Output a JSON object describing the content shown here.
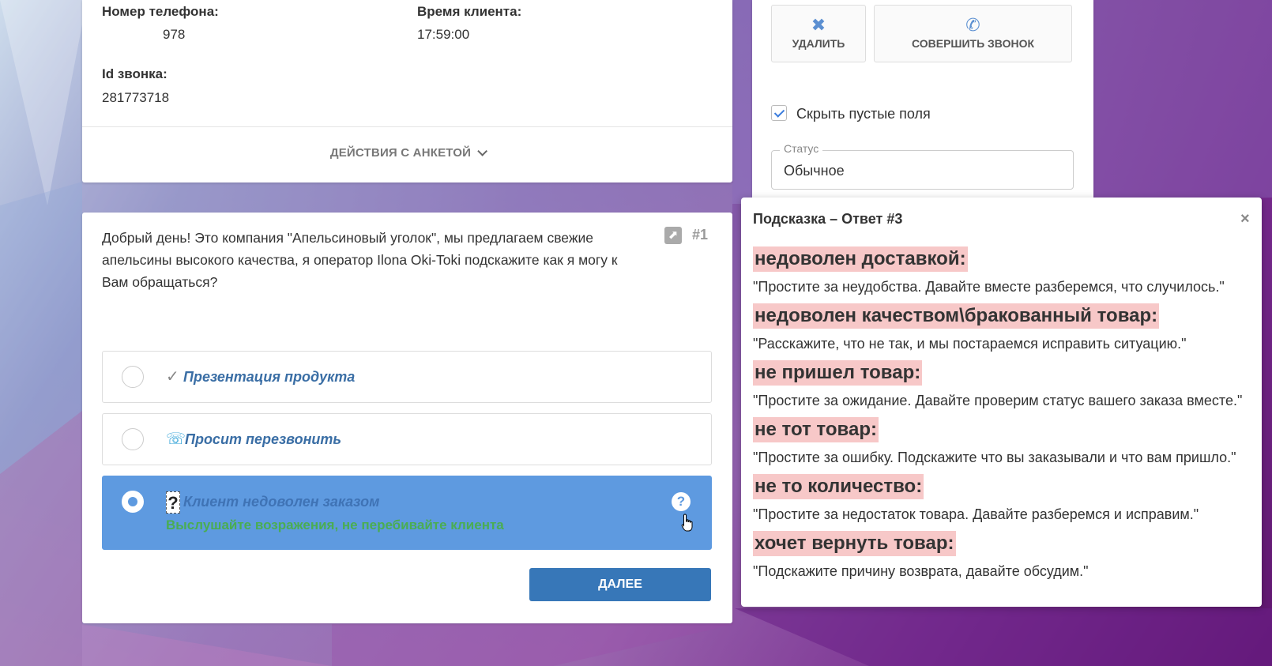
{
  "info": {
    "phone_label": "Номер телефона:",
    "phone_value": "978",
    "client_time_label": "Время клиента:",
    "client_time_value": "17:59:00",
    "call_id_label": "Id звонка:",
    "call_id_value": "281773718",
    "actions_label": "ДЕЙСТВИЯ С АНКЕТОЙ"
  },
  "side": {
    "delete_label": "УДАЛИТЬ",
    "call_label": "СОВЕРШИТЬ ЗВОНОК",
    "hide_empty_label": "Скрыть пустые поля",
    "hide_empty_checked": true,
    "status_legend": "Статус",
    "status_value": "Обычное"
  },
  "question": {
    "text": "Добрый день! Это компания \"Апельсиновый уголок\", мы предлагаем свежие апельсины высокого качества, я оператор Ilona Oki-Toki подскажите как я могу к Вам обращаться?",
    "number": "#1",
    "answers": [
      {
        "label": "Презентация продукта",
        "icon": "checkmark-icon",
        "selected": false
      },
      {
        "label": "Просит перезвонить",
        "icon": "phone-callback-icon",
        "selected": false
      },
      {
        "label": "Клиент недоволен заказом",
        "icon": "question-mark-icon",
        "selected": true,
        "hint": "Выслушайте возражения, не перебивайте клиента"
      }
    ],
    "next_label": "ДАЛЕЕ"
  },
  "hint_popup": {
    "title": "Подсказка – Ответ #3",
    "close": "×",
    "items": [
      {
        "key": "недоволен доставкой:",
        "reply": "\"Простите за неудобства. Давайте вместе разберемся, что случилось.\""
      },
      {
        "key": "недоволен качеством\\бракованный товар:",
        "reply": "\"Расскажите, что не так, и мы постараемся исправить ситуацию.\""
      },
      {
        "key": "не пришел товар:",
        "reply": "\"Простите за ожидание. Давайте проверим статус вашего заказа вместе.\""
      },
      {
        "key": "не тот товар:",
        "reply": "\"Простите за ошибку. Подскажите что вы заказывали и что вам пришло.\""
      },
      {
        "key": "не то количество:",
        "reply": "\"Простите за недостаток товара. Давайте разберемся и исправим.\""
      },
      {
        "key": "хочет вернуть товар:",
        "reply": "\"Подскажите причину возврата, давайте обсудим.\""
      }
    ]
  },
  "colors": {
    "accent_blue": "#3777b8",
    "selected_answer": "#5e9ae0",
    "hint_highlight": "#f7c8c8",
    "hint_green": "#4aad52"
  }
}
